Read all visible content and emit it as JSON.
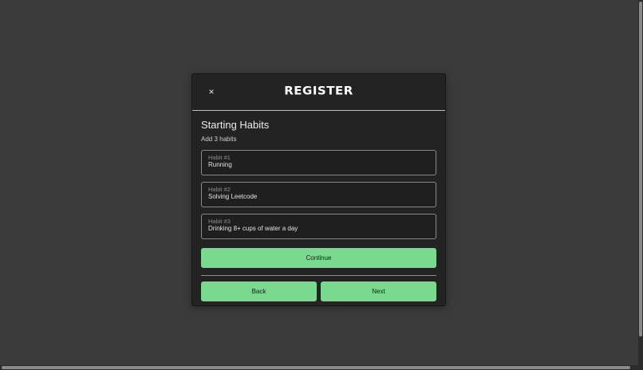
{
  "modal": {
    "close_glyph": "×",
    "logo_text": "REGISTER",
    "title": "Starting Habits",
    "subtitle": "Add 3 habits",
    "habits": [
      {
        "label": "Habit #1",
        "value": "Running"
      },
      {
        "label": "Habit #2",
        "value": "Solving Leetcode"
      },
      {
        "label": "Habit #3",
        "value": "Drinking 8+ cups of water a day"
      }
    ],
    "continue_label": "Continue",
    "back_label": "Back",
    "next_label": "Next"
  },
  "colors": {
    "background": "#3b3b3b",
    "modal_bg": "#232323",
    "accent": "#79d98e"
  }
}
